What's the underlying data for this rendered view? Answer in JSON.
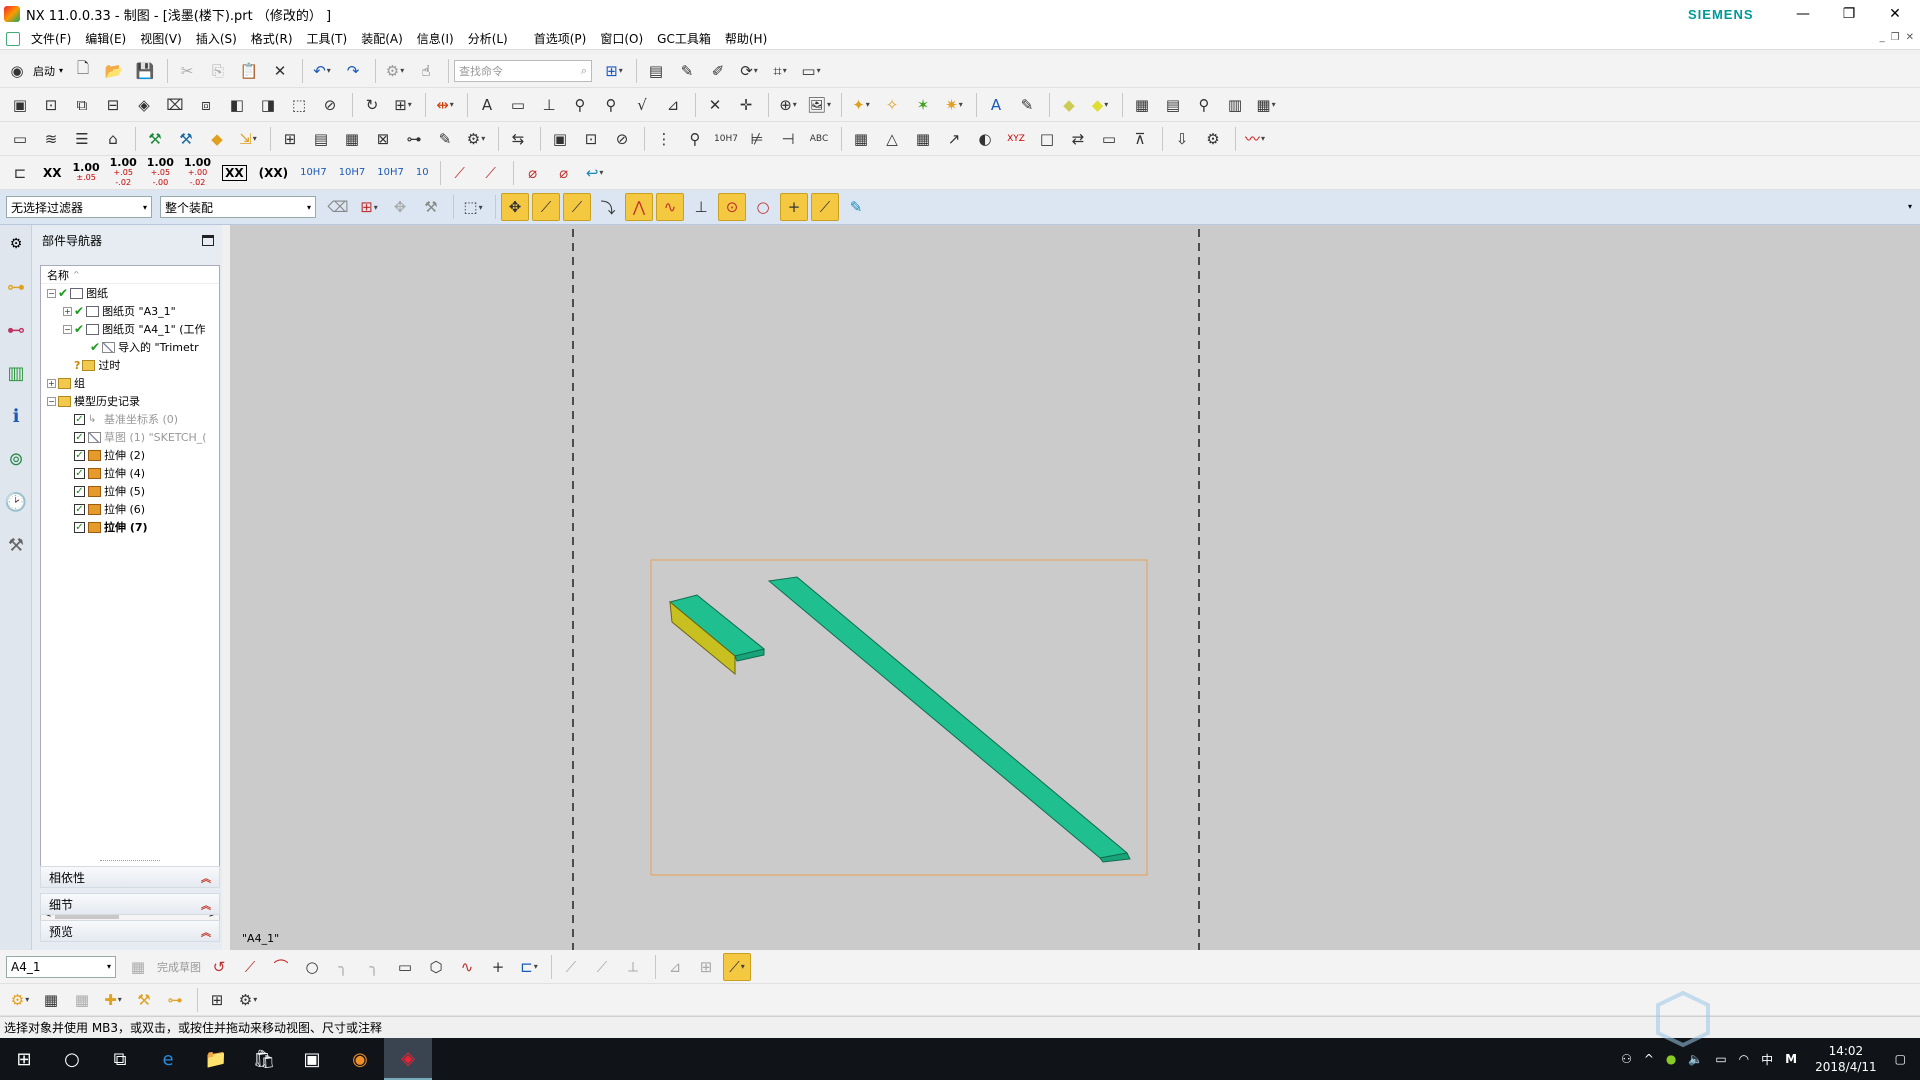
{
  "window": {
    "title": "NX 11.0.0.33 - 制图 - [浅墨(楼下).prt （修改的） ]",
    "brand": "SIEMENS",
    "controls": [
      "—",
      "❐",
      "✕"
    ]
  },
  "menubar": {
    "items": [
      "文件(F)",
      "编辑(E)",
      "视图(V)",
      "插入(S)",
      "格式(R)",
      "工具(T)",
      "装配(A)",
      "信息(I)",
      "分析(L)",
      "首选项(P)",
      "窗口(O)",
      "GC工具箱",
      "帮助(H)"
    ]
  },
  "toolbar": {
    "start_label": "启动",
    "search_placeholder": "查找命令",
    "dim_texts": [
      "XX",
      "1.00",
      "1.00",
      "1.00",
      "1.00",
      "XX",
      "(XX)",
      "10H7",
      "10H7",
      "10H7",
      "10"
    ]
  },
  "selection_bar": {
    "filter_value": "无选择过滤器",
    "scope_value": "整个装配"
  },
  "navigator": {
    "title": "部件导航器",
    "column_header": "名称",
    "tree": [
      {
        "label": "图纸",
        "level": 0,
        "expander": "−",
        "check": true,
        "icon": "drawing",
        "style": ""
      },
      {
        "label": "图纸页 \"A3_1\"",
        "level": 1,
        "expander": "+",
        "check": true,
        "icon": "sheet",
        "style": ""
      },
      {
        "label": "图纸页 \"A4_1\" (工作",
        "level": 1,
        "expander": "−",
        "check": true,
        "icon": "sheet",
        "style": ""
      },
      {
        "label": "导入的 \"Trimetr",
        "level": 2,
        "expander": "",
        "check": true,
        "icon": "view",
        "style": ""
      },
      {
        "label": "过时",
        "level": 1,
        "expander": "",
        "check": false,
        "icon": "folder-q",
        "style": ""
      },
      {
        "label": "组",
        "level": 0,
        "expander": "+",
        "check": false,
        "icon": "folder",
        "style": ""
      },
      {
        "label": "模型历史记录",
        "level": 0,
        "expander": "−",
        "check": false,
        "icon": "folder",
        "style": ""
      },
      {
        "label": "基准坐标系 (0)",
        "level": 1,
        "expander": "",
        "check": true,
        "icon": "csys",
        "style": "dim",
        "box": true
      },
      {
        "label": "草图 (1) \"SKETCH_(",
        "level": 1,
        "expander": "",
        "check": true,
        "icon": "sketch",
        "style": "dim",
        "box": true
      },
      {
        "label": "拉伸 (2)",
        "level": 1,
        "expander": "",
        "check": true,
        "icon": "extrude",
        "style": "",
        "box": true
      },
      {
        "label": "拉伸 (4)",
        "level": 1,
        "expander": "",
        "check": true,
        "icon": "extrude",
        "style": "",
        "box": true
      },
      {
        "label": "拉伸 (5)",
        "level": 1,
        "expander": "",
        "check": true,
        "icon": "extrude",
        "style": "",
        "box": true
      },
      {
        "label": "拉伸 (6)",
        "level": 1,
        "expander": "",
        "check": true,
        "icon": "extrude",
        "style": "",
        "box": true
      },
      {
        "label": "拉伸 (7)",
        "level": 1,
        "expander": "",
        "check": true,
        "icon": "extrude",
        "style": "bold",
        "box": true
      }
    ],
    "panels": [
      "相依性",
      "细节",
      "预览"
    ]
  },
  "graphics": {
    "sheet_label": "\"A4_1\"",
    "colors": {
      "background": "#cbcbcb",
      "border": "#e8a050",
      "part_green": "#1fbf8f",
      "part_yellow": "#c8c020"
    }
  },
  "bottom_toolbar": {
    "sheet_select": "A4_1",
    "finish_sketch": "完成草图"
  },
  "status": {
    "message": "选择对象并使用 MB3，或双击，或按住并拖动来移动视图、尺寸或注释"
  },
  "taskbar": {
    "time": "14:02",
    "date": "2018/4/11",
    "ime_mode": "中",
    "ime_letter": "M"
  }
}
